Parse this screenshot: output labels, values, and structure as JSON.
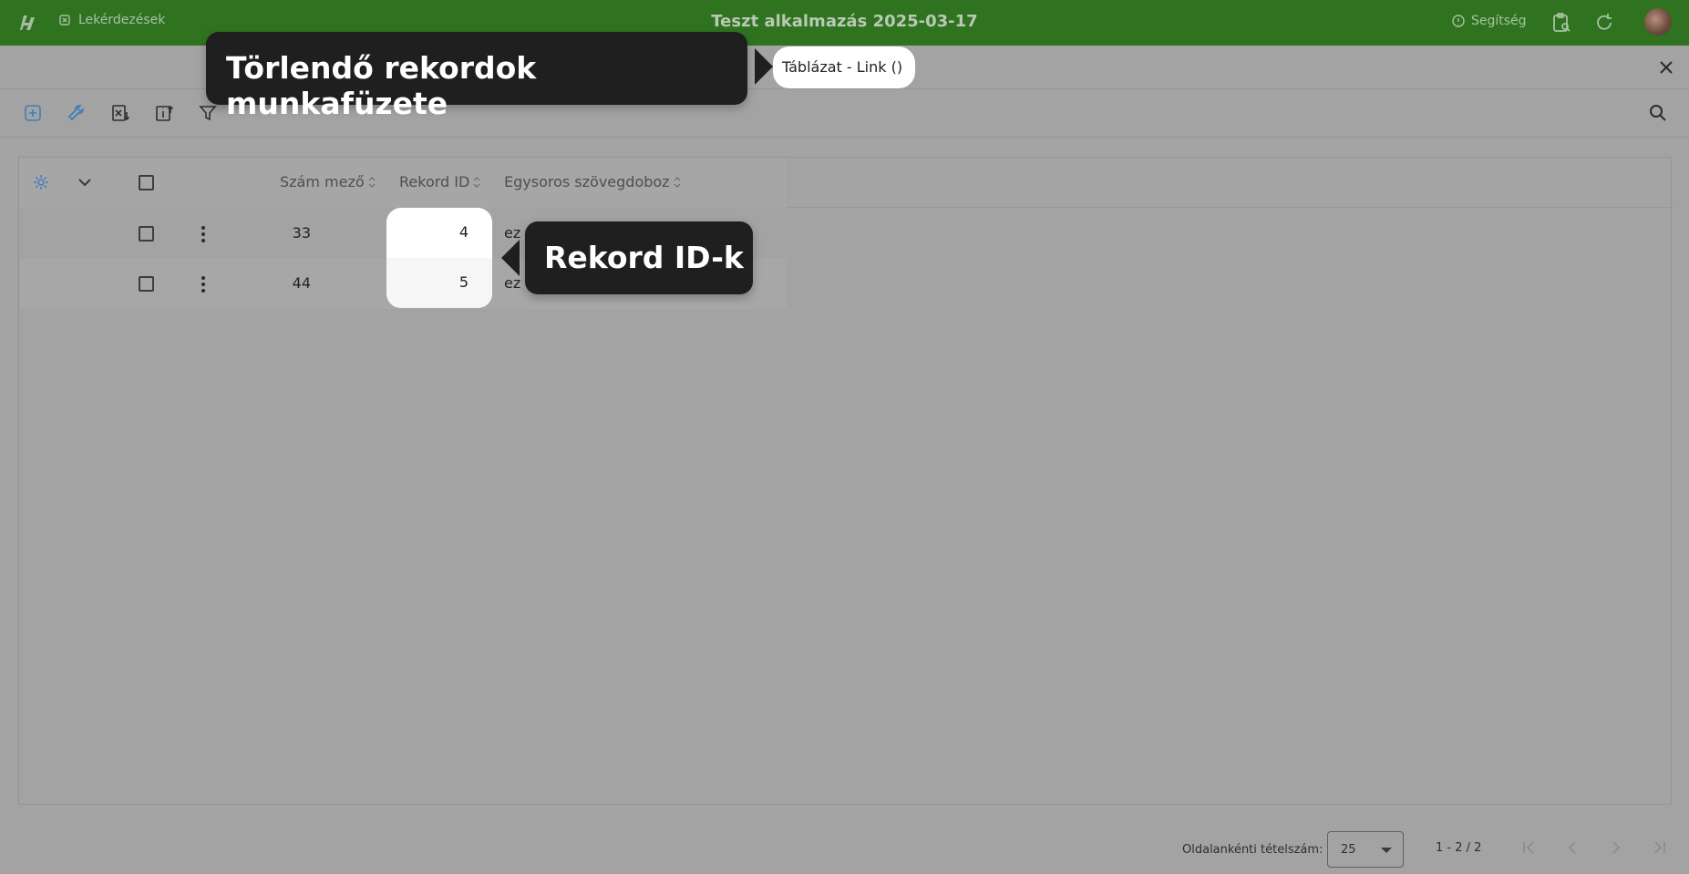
{
  "topbar": {
    "breadcrumb": "Lekérdezések",
    "title": "Teszt alkalmazás 2025-03-17",
    "help_label": "Segítség"
  },
  "callouts": {
    "workbook": "Törlendő rekordok munkafüzete",
    "record_ids": "Rekord ID-k"
  },
  "tab_pill": "Táblázat - Link ()",
  "table": {
    "columns": [
      "Szám mező",
      "Rekord ID",
      "Egysoros szövegdoboz"
    ],
    "rows": [
      {
        "szam": "33",
        "rekord_id": "4",
        "szoveg": "ez n"
      },
      {
        "szam": "44",
        "rekord_id": "5",
        "szoveg": "ez n"
      }
    ]
  },
  "footer": {
    "per_page_label": "Oldalankénti tételszám:",
    "per_page_value": "25",
    "range": "1 - 2 / 2"
  },
  "colors": {
    "topbar": "#2f7321",
    "accent": "#3f7fbf",
    "overlay": "#a3a3a3",
    "callout": "#1f1f1f"
  }
}
